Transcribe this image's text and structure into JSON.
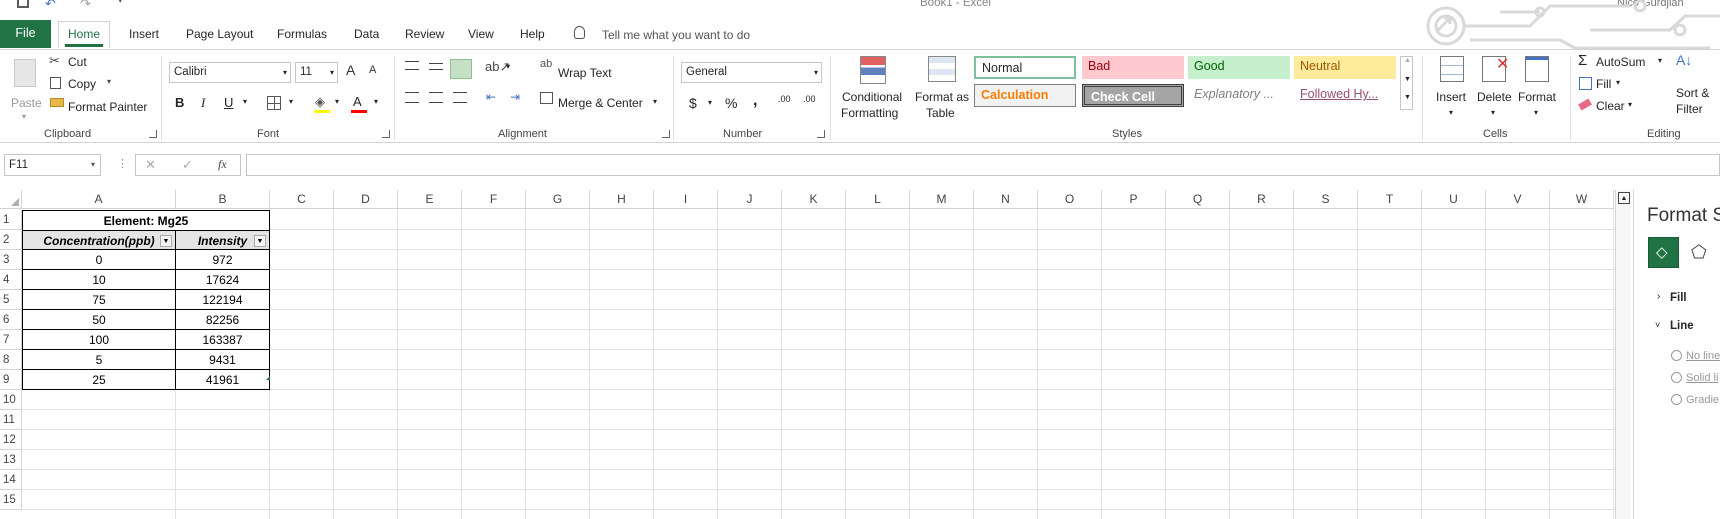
{
  "window": {
    "title": "Book1  -  Excel",
    "user": "Nico Gurdjian"
  },
  "tabs": [
    "File",
    "Home",
    "Insert",
    "Page Layout",
    "Formulas",
    "Data",
    "Review",
    "View",
    "Help"
  ],
  "tell_me": "Tell me what you want to do",
  "clipboard": {
    "paste": "Paste",
    "cut": "Cut",
    "copy": "Copy",
    "format_painter": "Format Painter",
    "label": "Clipboard"
  },
  "font": {
    "name": "Calibri",
    "size": "11",
    "bold": "B",
    "italic": "I",
    "underline": "U",
    "label": "Font",
    "grow": "A",
    "shrink": "A",
    "color_letter": "A"
  },
  "alignment": {
    "wrap_text": "Wrap Text",
    "merge_center": "Merge & Center",
    "label": "Alignment"
  },
  "number": {
    "format": "General",
    "currency": "$",
    "percent": "%",
    "comma": ",",
    "inc_decimal": ".00",
    "dec_decimal": ".00",
    "label": "Number"
  },
  "styles": {
    "conditional": [
      "Conditional",
      "Formatting"
    ],
    "format_table": [
      "Format as",
      "Table"
    ],
    "cells": [
      {
        "label": "Normal",
        "bg": "#ffffff",
        "fg": "#000000"
      },
      {
        "label": "Bad",
        "bg": "#ffc7ce",
        "fg": "#9c0006"
      },
      {
        "label": "Good",
        "bg": "#c6efce",
        "fg": "#006100"
      },
      {
        "label": "Neutral",
        "bg": "#ffeb9c",
        "fg": "#9c5700"
      },
      {
        "label": "Calculation",
        "bg": "#f2f2f2",
        "fg": "#fa7d00"
      },
      {
        "label": "Check Cell",
        "bg": "#a5a5a5",
        "fg": "#ffffff"
      },
      {
        "label": "Explanatory ...",
        "bg": "#ffffff",
        "fg": "#7f7f7f"
      },
      {
        "label": "Followed Hy...",
        "bg": "#ffffff",
        "fg": "#954f72"
      }
    ],
    "label": "Styles"
  },
  "cells_group": {
    "insert": "Insert",
    "delete": "Delete",
    "format": "Format",
    "label": "Cells"
  },
  "editing": {
    "autosum": "AutoSum",
    "fill": "Fill",
    "clear": "Clear",
    "sort": [
      "Sort &",
      "Filter"
    ],
    "label": "Editing"
  },
  "formula_bar": {
    "name_box": "F11",
    "fx": "fx",
    "value": ""
  },
  "columns": [
    "A",
    "B",
    "C",
    "D",
    "E",
    "F",
    "G",
    "H",
    "I",
    "J",
    "K",
    "L",
    "M",
    "N",
    "O",
    "P",
    "Q",
    "R",
    "S",
    "T",
    "U",
    "V",
    "W"
  ],
  "rows": [
    "1",
    "2",
    "3",
    "4",
    "5",
    "6",
    "7",
    "8",
    "9",
    "10",
    "11",
    "12",
    "13",
    "14",
    "15"
  ],
  "table": {
    "title": "Element: Mg25",
    "headers": [
      "Concentration(ppb)",
      "Intensity"
    ],
    "rows": [
      [
        "0",
        "972"
      ],
      [
        "10",
        "17624"
      ],
      [
        "75",
        "122194"
      ],
      [
        "50",
        "82256"
      ],
      [
        "100",
        "163387"
      ],
      [
        "5",
        "9431"
      ],
      [
        "25",
        "41961"
      ]
    ]
  },
  "format_pane": {
    "title": "Format S",
    "fill": "Fill",
    "line": "Line",
    "options": [
      "No line",
      "Solid li",
      "Gradie"
    ]
  },
  "colors": {
    "accent": "#217346",
    "selection_green": "#217346"
  }
}
